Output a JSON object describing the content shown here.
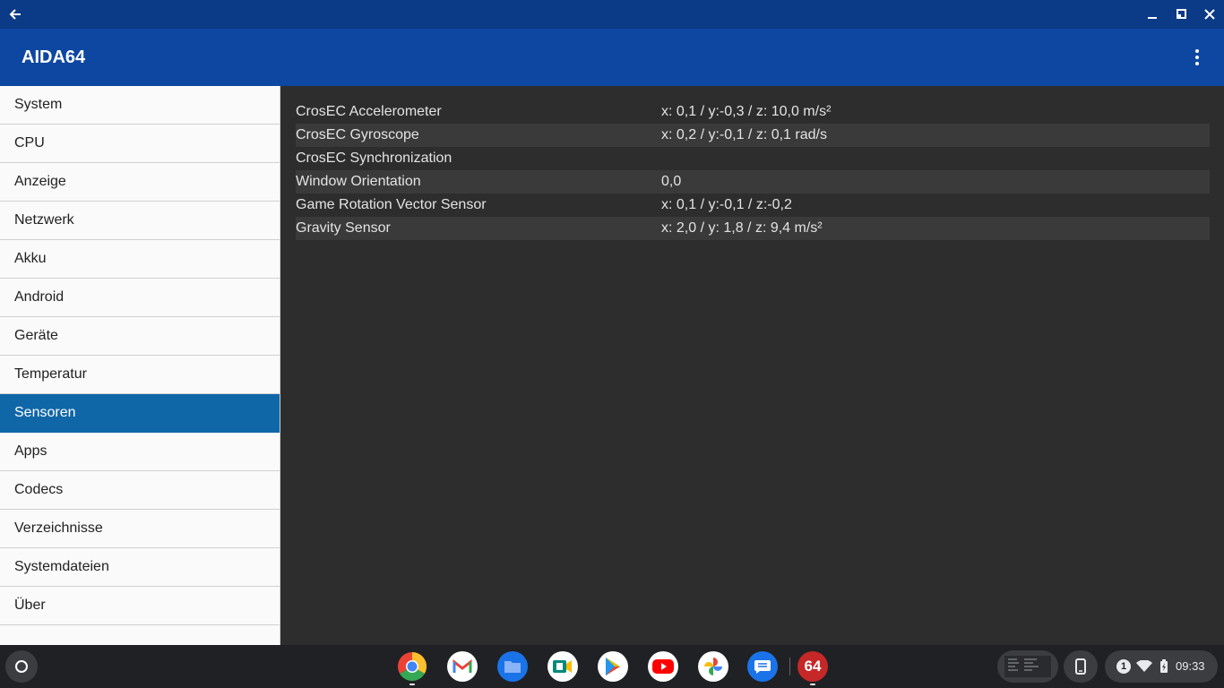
{
  "app": {
    "title": "AIDA64"
  },
  "sidebar": {
    "items": [
      {
        "label": "System",
        "active": false
      },
      {
        "label": "CPU",
        "active": false
      },
      {
        "label": "Anzeige",
        "active": false
      },
      {
        "label": "Netzwerk",
        "active": false
      },
      {
        "label": "Akku",
        "active": false
      },
      {
        "label": "Android",
        "active": false
      },
      {
        "label": "Geräte",
        "active": false
      },
      {
        "label": "Temperatur",
        "active": false
      },
      {
        "label": "Sensoren",
        "active": true
      },
      {
        "label": "Apps",
        "active": false
      },
      {
        "label": "Codecs",
        "active": false
      },
      {
        "label": "Verzeichnisse",
        "active": false
      },
      {
        "label": "Systemdateien",
        "active": false
      },
      {
        "label": "Über",
        "active": false
      }
    ]
  },
  "sensors": [
    {
      "name": "CrosEC Accelerometer",
      "value": "x: 0,1 / y:-0,3 / z: 10,0 m/s²"
    },
    {
      "name": "CrosEC Gyroscope",
      "value": "x: 0,2 / y:-0,1 / z: 0,1 rad/s"
    },
    {
      "name": "CrosEC Synchronization",
      "value": ""
    },
    {
      "name": "Window Orientation",
      "value": "0,0"
    },
    {
      "name": "Game Rotation Vector Sensor",
      "value": "x: 0,1 / y:-0,1 / z:-0,2"
    },
    {
      "name": "Gravity Sensor",
      "value": "x: 2,0 / y: 1,8 / z: 9,4 m/s²"
    }
  ],
  "shelf": {
    "apps": [
      "chrome-icon",
      "gmail-icon",
      "files-icon",
      "meet-icon",
      "play-store-icon",
      "youtube-icon",
      "photos-icon",
      "messages-icon",
      "aida64-icon"
    ],
    "aida64_icon_text": "64",
    "notification_count": "1",
    "time": "09:33"
  },
  "colors": {
    "titlebar": "#0b3a86",
    "appbar": "#0e47a1",
    "active_item": "#1067a8",
    "content_bg": "#2d2d2d",
    "row_alt": "#3a3a3a"
  }
}
